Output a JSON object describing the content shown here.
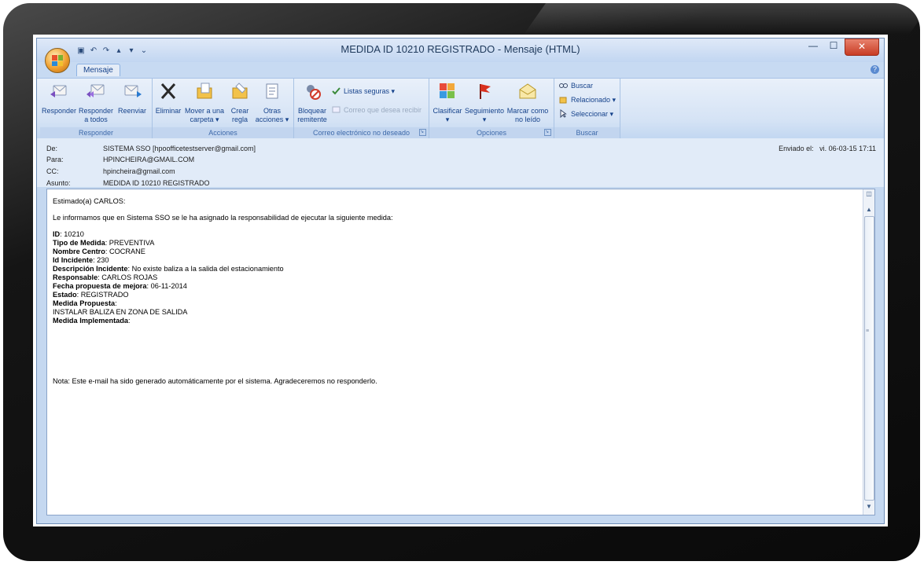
{
  "window": {
    "title": "MEDIDA ID 10210 REGISTRADO - Mensaje (HTML)",
    "controls": {
      "minimize": "—",
      "maximize": "☐",
      "close": "✕"
    }
  },
  "quick_access": [
    "save-icon",
    "undo-icon",
    "redo-icon",
    "up-icon",
    "down-icon",
    "customize-icon"
  ],
  "tabs": [
    {
      "label": "Mensaje",
      "active": true
    }
  ],
  "ribbon": {
    "groups": [
      {
        "label": "Responder",
        "buttons": [
          {
            "label": "Responder",
            "icon": "reply-icon"
          },
          {
            "label": "Responder a todos",
            "line1": "Responder",
            "line2": "a todos",
            "icon": "reply-all-icon"
          },
          {
            "label": "Reenviar",
            "icon": "forward-icon"
          }
        ]
      },
      {
        "label": "Acciones",
        "buttons": [
          {
            "label": "Eliminar",
            "icon": "delete-icon"
          },
          {
            "line1": "Mover a una",
            "line2": "carpeta ▾",
            "icon": "move-folder-icon"
          },
          {
            "line1": "Crear",
            "line2": "regla",
            "icon": "create-rule-icon"
          },
          {
            "line1": "Otras",
            "line2": "acciones ▾",
            "icon": "other-actions-icon"
          }
        ]
      },
      {
        "label": "Correo electrónico no deseado",
        "buttons": [
          {
            "line1": "Bloquear",
            "line2": "remitente",
            "icon": "block-sender-icon"
          },
          {
            "label": "Listas seguras ▾",
            "icon": "safe-lists-icon"
          },
          {
            "label": "Correo que desea recibir",
            "icon": "not-junk-icon",
            "disabled": true
          }
        ]
      },
      {
        "label": "Opciones",
        "buttons": [
          {
            "line1": "Clasificar",
            "line2": "▾",
            "icon": "categorize-icon"
          },
          {
            "line1": "Seguimiento",
            "line2": "▾",
            "icon": "follow-up-flag-icon"
          },
          {
            "line1": "Marcar como",
            "line2": "no leído",
            "icon": "mark-unread-icon"
          }
        ]
      },
      {
        "label": "Buscar",
        "buttons": [
          {
            "label": "Buscar",
            "icon": "find-icon"
          },
          {
            "label": "Relacionado ▾",
            "icon": "related-icon"
          },
          {
            "label": "Seleccionar ▾",
            "icon": "select-icon"
          }
        ]
      }
    ]
  },
  "header": {
    "from_label": "De:",
    "from": "SISTEMA SSO [hpoofficetestserver@gmail.com]",
    "to_label": "Para:",
    "to": "HPINCHEIRA@GMAIL.COM",
    "cc_label": "CC:",
    "cc": "hpincheira@gmail.com",
    "subject_label": "Asunto:",
    "subject": "MEDIDA ID 10210 REGISTRADO",
    "sent_label": "Enviado el:",
    "sent": "vi. 06-03-15 17:11"
  },
  "body": {
    "greeting": "Estimado(a) CARLOS:",
    "intro": "Le informamos que en Sistema SSO se le ha asignado la responsabilidad de ejecutar la siguiente medida:",
    "fields": [
      {
        "label": "ID",
        "value": ": 10210"
      },
      {
        "label": "Tipo de Medida",
        "value": ": PREVENTIVA"
      },
      {
        "label": "Nombre Centro",
        "value": ": COCRANE"
      },
      {
        "label": "Id Incidente",
        "value": ": 230"
      },
      {
        "label": "Descripción Incidente",
        "value": ": No existe baliza a la salida del estacionamiento"
      },
      {
        "label": "Responsable",
        "value": ": CARLOS ROJAS"
      },
      {
        "label": "Fecha propuesta de mejora",
        "value": ": 06-11-2014"
      },
      {
        "label": "Estado",
        "value": ": REGISTRADO"
      },
      {
        "label": "Medida Propuesta",
        "value": ":"
      }
    ],
    "proposed_text": "INSTALAR BALIZA EN ZONA DE SALIDA",
    "implemented_label": "Medida Implementada",
    "implemented_value": ":",
    "note": "Nota: Este e-mail ha sido generado automáticamente por el sistema. Agradeceremos no responderlo."
  }
}
